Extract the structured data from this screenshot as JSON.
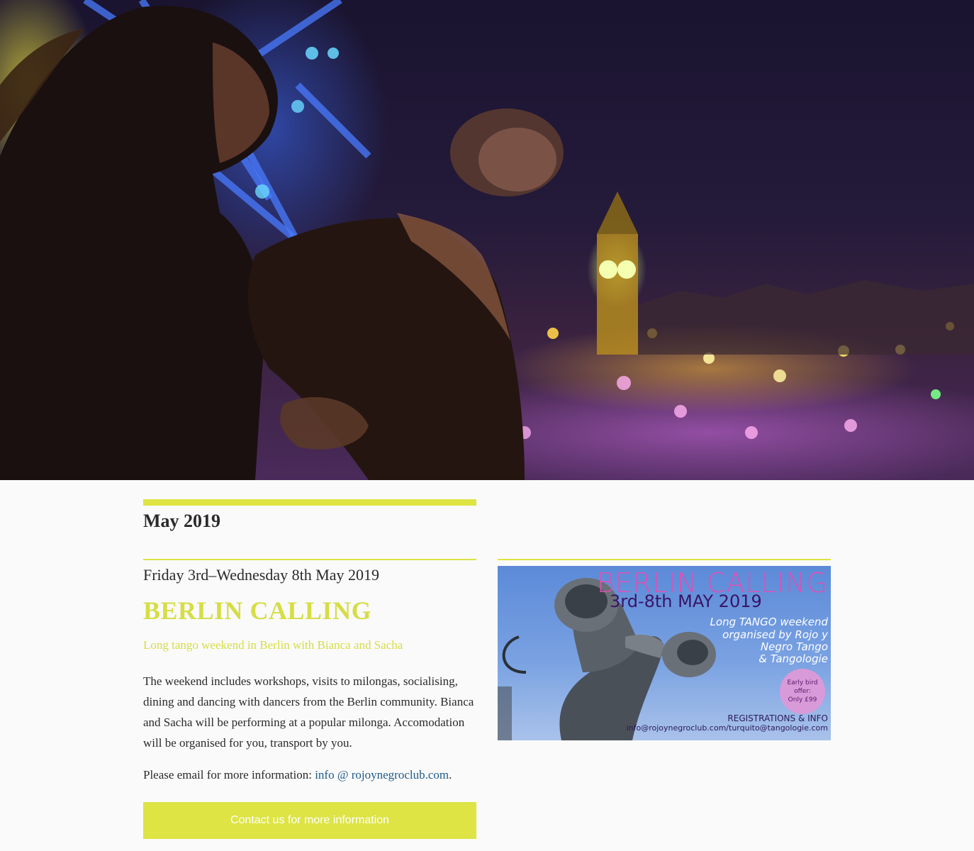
{
  "hero": {
    "icon": "tango-couple-london-night-photo"
  },
  "section": {
    "month_title": "May 2019"
  },
  "event": {
    "date": "Friday 3rd–Wednesday 8th May 2019",
    "title": "BERLIN CALLING",
    "subtitle": "Long tango weekend in Berlin with Bianca and Sacha",
    "description": "The weekend includes workshops, visits to milongas, socialising, dining and dancing with dancers from the Berlin community. Bianca and Sacha will be performing at a popular milonga. Accomodation will be organised for you, transport by you.",
    "contact_prefix": "Please email for more information: ",
    "contact_link": "info @ rojoynegroclub.com",
    "contact_suffix": ".",
    "cta_label": "Contact us for more information"
  },
  "poster": {
    "title": "BERLIN CALLING",
    "dates": "3rd-8th MAY 2019",
    "line1": "Long TANGO weekend",
    "line2": "organised by Rojo y",
    "line3": "Negro Tango",
    "line4": "& Tangologie",
    "badge_line1": "Early bird",
    "badge_line2": "offer:",
    "badge_line3": "Only £99",
    "registrations": "REGISTRATIONS & INFO",
    "emails": "info@rojoynegroclub.com/turquito@tangologie.com"
  },
  "colors": {
    "accent": "#dde444",
    "link": "#1e5a8a",
    "poster_title": "#e04fb4"
  }
}
